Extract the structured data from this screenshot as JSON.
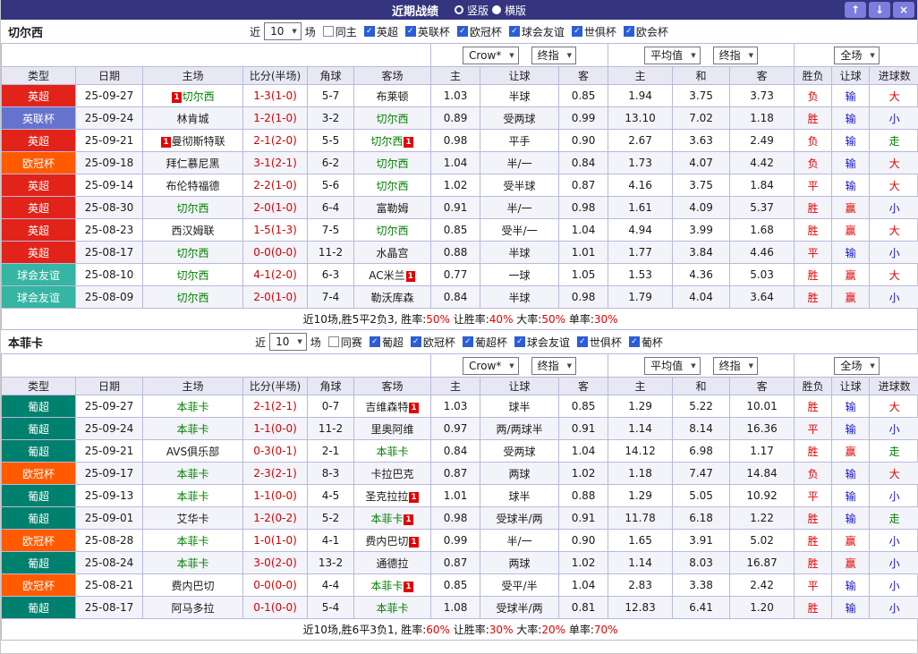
{
  "titlebar": {
    "title": "近期战绩",
    "radios": [
      {
        "label": "竖版",
        "selected": true
      },
      {
        "label": "横版",
        "selected": false
      }
    ],
    "buttons": [
      {
        "name": "scroll-up-button",
        "glyph": "↑"
      },
      {
        "name": "scroll-down-button",
        "glyph": "↓"
      },
      {
        "name": "close-button",
        "glyph": "×"
      }
    ]
  },
  "columns": [
    "类型",
    "日期",
    "主场",
    "比分(半场)",
    "角球",
    "客场",
    "主",
    "让球",
    "客",
    "主",
    "和",
    "客",
    "胜负",
    "让球",
    "进球数"
  ],
  "colors": {
    "leagues": {
      "英超": "#e2231a",
      "英联杯": "#6673ce",
      "欧冠杯": "#ff5a00",
      "球会友谊": "#35b5a2",
      "葡超": "#00806e"
    },
    "results": {
      "胜": "#e60000",
      "平": "#e60000",
      "负": "#e60000",
      "赢": "#e60000",
      "输": "#1414cc",
      "大": "#e60000",
      "小": "#1414cc",
      "走": "#008000"
    }
  },
  "sections": [
    {
      "team": "切尔西",
      "filter": {
        "prefix": "近",
        "count": "10",
        "suffix": "场",
        "checkboxes": [
          {
            "label": "同主",
            "checked": false
          },
          {
            "label": "英超",
            "checked": true
          },
          {
            "label": "英联杯",
            "checked": true
          },
          {
            "label": "欧冠杯",
            "checked": true
          },
          {
            "label": "球会友谊",
            "checked": true
          },
          {
            "label": "世俱杯",
            "checked": true
          },
          {
            "label": "欧会杯",
            "checked": true
          }
        ]
      },
      "dropdown_groups": [
        [
          "Crow*",
          "终指"
        ],
        [
          "平均值",
          "终指"
        ],
        [
          "全场"
        ]
      ],
      "rows": [
        {
          "league": "英超",
          "date": "25-09-27",
          "home": {
            "name": "切尔西",
            "self": true,
            "badge": "1",
            "badge_pos": "before"
          },
          "score": "1-3(1-0)",
          "corners": "5-7",
          "away": {
            "name": "布莱顿"
          },
          "odds": [
            "1.03",
            "半球",
            "0.85"
          ],
          "avg": [
            "1.94",
            "3.75",
            "3.73"
          ],
          "results": [
            "负",
            "输",
            "大"
          ]
        },
        {
          "league": "英联杯",
          "date": "25-09-24",
          "home": {
            "name": "林肯城"
          },
          "score": "1-2(1-0)",
          "corners": "3-2",
          "away": {
            "name": "切尔西",
            "self": true
          },
          "odds": [
            "0.89",
            "受两球",
            "0.99"
          ],
          "avg": [
            "13.10",
            "7.02",
            "1.18"
          ],
          "results": [
            "胜",
            "输",
            "小"
          ]
        },
        {
          "league": "英超",
          "date": "25-09-21",
          "home": {
            "name": "曼彻斯特联",
            "badge": "1",
            "badge_pos": "before"
          },
          "score": "2-1(2-0)",
          "corners": "5-5",
          "away": {
            "name": "切尔西",
            "self": true,
            "badge": "1",
            "badge_pos": "after"
          },
          "odds": [
            "0.98",
            "平手",
            "0.90"
          ],
          "avg": [
            "2.67",
            "3.63",
            "2.49"
          ],
          "results": [
            "负",
            "输",
            "走"
          ]
        },
        {
          "league": "欧冠杯",
          "date": "25-09-18",
          "home": {
            "name": "拜仁慕尼黑"
          },
          "score": "3-1(2-1)",
          "corners": "6-2",
          "away": {
            "name": "切尔西",
            "self": true
          },
          "odds": [
            "1.04",
            "半/一",
            "0.84"
          ],
          "avg": [
            "1.73",
            "4.07",
            "4.42"
          ],
          "results": [
            "负",
            "输",
            "大"
          ]
        },
        {
          "league": "英超",
          "date": "25-09-14",
          "home": {
            "name": "布伦特福德"
          },
          "score": "2-2(1-0)",
          "corners": "5-6",
          "away": {
            "name": "切尔西",
            "self": true
          },
          "odds": [
            "1.02",
            "受半球",
            "0.87"
          ],
          "avg": [
            "4.16",
            "3.75",
            "1.84"
          ],
          "results": [
            "平",
            "输",
            "大"
          ]
        },
        {
          "league": "英超",
          "date": "25-08-30",
          "home": {
            "name": "切尔西",
            "self": true
          },
          "score": "2-0(1-0)",
          "corners": "6-4",
          "away": {
            "name": "富勒姆"
          },
          "odds": [
            "0.91",
            "半/一",
            "0.98"
          ],
          "avg": [
            "1.61",
            "4.09",
            "5.37"
          ],
          "results": [
            "胜",
            "赢",
            "小"
          ]
        },
        {
          "league": "英超",
          "date": "25-08-23",
          "home": {
            "name": "西汉姆联"
          },
          "score": "1-5(1-3)",
          "corners": "7-5",
          "away": {
            "name": "切尔西",
            "self": true
          },
          "odds": [
            "0.85",
            "受半/一",
            "1.04"
          ],
          "avg": [
            "4.94",
            "3.99",
            "1.68"
          ],
          "results": [
            "胜",
            "赢",
            "大"
          ]
        },
        {
          "league": "英超",
          "date": "25-08-17",
          "home": {
            "name": "切尔西",
            "self": true
          },
          "score": "0-0(0-0)",
          "corners": "11-2",
          "away": {
            "name": "水晶宫"
          },
          "odds": [
            "0.88",
            "半球",
            "1.01"
          ],
          "avg": [
            "1.77",
            "3.84",
            "4.46"
          ],
          "results": [
            "平",
            "输",
            "小"
          ]
        },
        {
          "league": "球会友谊",
          "date": "25-08-10",
          "home": {
            "name": "切尔西",
            "self": true
          },
          "score": "4-1(2-0)",
          "corners": "6-3",
          "away": {
            "name": "AC米兰",
            "badge": "1",
            "badge_pos": "after"
          },
          "odds": [
            "0.77",
            "一球",
            "1.05"
          ],
          "avg": [
            "1.53",
            "4.36",
            "5.03"
          ],
          "results": [
            "胜",
            "赢",
            "大"
          ]
        },
        {
          "league": "球会友谊",
          "date": "25-08-09",
          "home": {
            "name": "切尔西",
            "self": true
          },
          "score": "2-0(1-0)",
          "corners": "7-4",
          "away": {
            "name": "勒沃库森"
          },
          "odds": [
            "0.84",
            "半球",
            "0.98"
          ],
          "avg": [
            "1.79",
            "4.04",
            "3.64"
          ],
          "results": [
            "胜",
            "赢",
            "小"
          ]
        }
      ],
      "summary": {
        "prefix": "近10场,胜5平2负3,",
        "stats": [
          {
            "label": "胜率:",
            "value": "50%"
          },
          {
            "label": "让胜率:",
            "value": "40%"
          },
          {
            "label": "大率:",
            "value": "50%"
          },
          {
            "label": "单率:",
            "value": "30%"
          }
        ]
      }
    },
    {
      "team": "本菲卡",
      "filter": {
        "prefix": "近",
        "count": "10",
        "suffix": "场",
        "checkboxes": [
          {
            "label": "同赛",
            "checked": false
          },
          {
            "label": "葡超",
            "checked": true
          },
          {
            "label": "欧冠杯",
            "checked": true
          },
          {
            "label": "葡超杯",
            "checked": true
          },
          {
            "label": "球会友谊",
            "checked": true
          },
          {
            "label": "世俱杯",
            "checked": true
          },
          {
            "label": "葡杯",
            "checked": true
          }
        ]
      },
      "dropdown_groups": [
        [
          "Crow*",
          "终指"
        ],
        [
          "平均值",
          "终指"
        ],
        [
          "全场"
        ]
      ],
      "rows": [
        {
          "league": "葡超",
          "date": "25-09-27",
          "home": {
            "name": "本菲卡",
            "self": true
          },
          "score": "2-1(2-1)",
          "corners": "0-7",
          "away": {
            "name": "吉维森特",
            "badge": "1",
            "badge_pos": "after"
          },
          "odds": [
            "1.03",
            "球半",
            "0.85"
          ],
          "avg": [
            "1.29",
            "5.22",
            "10.01"
          ],
          "results": [
            "胜",
            "输",
            "大"
          ]
        },
        {
          "league": "葡超",
          "date": "25-09-24",
          "home": {
            "name": "本菲卡",
            "self": true
          },
          "score": "1-1(0-0)",
          "corners": "11-2",
          "away": {
            "name": "里奥阿维"
          },
          "odds": [
            "0.97",
            "两/两球半",
            "0.91"
          ],
          "avg": [
            "1.14",
            "8.14",
            "16.36"
          ],
          "results": [
            "平",
            "输",
            "小"
          ]
        },
        {
          "league": "葡超",
          "date": "25-09-21",
          "home": {
            "name": "AVS俱乐部"
          },
          "score": "0-3(0-1)",
          "corners": "2-1",
          "away": {
            "name": "本菲卡",
            "self": true
          },
          "odds": [
            "0.84",
            "受两球",
            "1.04"
          ],
          "avg": [
            "14.12",
            "6.98",
            "1.17"
          ],
          "results": [
            "胜",
            "赢",
            "走"
          ]
        },
        {
          "league": "欧冠杯",
          "date": "25-09-17",
          "home": {
            "name": "本菲卡",
            "self": true
          },
          "score": "2-3(2-1)",
          "corners": "8-3",
          "away": {
            "name": "卡拉巴克"
          },
          "odds": [
            "0.87",
            "两球",
            "1.02"
          ],
          "avg": [
            "1.18",
            "7.47",
            "14.84"
          ],
          "results": [
            "负",
            "输",
            "大"
          ]
        },
        {
          "league": "葡超",
          "date": "25-09-13",
          "home": {
            "name": "本菲卡",
            "self": true
          },
          "score": "1-1(0-0)",
          "corners": "4-5",
          "away": {
            "name": "圣克拉拉",
            "badge": "1",
            "badge_pos": "after"
          },
          "odds": [
            "1.01",
            "球半",
            "0.88"
          ],
          "avg": [
            "1.29",
            "5.05",
            "10.92"
          ],
          "results": [
            "平",
            "输",
            "小"
          ]
        },
        {
          "league": "葡超",
          "date": "25-09-01",
          "home": {
            "name": "艾华卡"
          },
          "score": "1-2(0-2)",
          "corners": "5-2",
          "away": {
            "name": "本菲卡",
            "self": true,
            "badge": "1",
            "badge_pos": "after"
          },
          "odds": [
            "0.98",
            "受球半/两",
            "0.91"
          ],
          "avg": [
            "11.78",
            "6.18",
            "1.22"
          ],
          "results": [
            "胜",
            "输",
            "走"
          ]
        },
        {
          "league": "欧冠杯",
          "date": "25-08-28",
          "home": {
            "name": "本菲卡",
            "self": true
          },
          "score": "1-0(1-0)",
          "corners": "4-1",
          "away": {
            "name": "费内巴切",
            "badge": "1",
            "badge_pos": "after"
          },
          "odds": [
            "0.99",
            "半/一",
            "0.90"
          ],
          "avg": [
            "1.65",
            "3.91",
            "5.02"
          ],
          "results": [
            "胜",
            "赢",
            "小"
          ]
        },
        {
          "league": "葡超",
          "date": "25-08-24",
          "home": {
            "name": "本菲卡",
            "self": true
          },
          "score": "3-0(2-0)",
          "corners": "13-2",
          "away": {
            "name": "通德拉"
          },
          "odds": [
            "0.87",
            "两球",
            "1.02"
          ],
          "avg": [
            "1.14",
            "8.03",
            "16.87"
          ],
          "results": [
            "胜",
            "赢",
            "小"
          ]
        },
        {
          "league": "欧冠杯",
          "date": "25-08-21",
          "home": {
            "name": "费内巴切"
          },
          "score": "0-0(0-0)",
          "corners": "4-4",
          "away": {
            "name": "本菲卡",
            "self": true,
            "badge": "1",
            "badge_pos": "after"
          },
          "odds": [
            "0.85",
            "受平/半",
            "1.04"
          ],
          "avg": [
            "2.83",
            "3.38",
            "2.42"
          ],
          "results": [
            "平",
            "输",
            "小"
          ]
        },
        {
          "league": "葡超",
          "date": "25-08-17",
          "home": {
            "name": "阿马多拉"
          },
          "score": "0-1(0-0)",
          "corners": "5-4",
          "away": {
            "name": "本菲卡",
            "self": true
          },
          "odds": [
            "1.08",
            "受球半/两",
            "0.81"
          ],
          "avg": [
            "12.83",
            "6.41",
            "1.20"
          ],
          "results": [
            "胜",
            "输",
            "小"
          ]
        }
      ],
      "summary": {
        "prefix": "近10场,胜6平3负1,",
        "stats": [
          {
            "label": "胜率:",
            "value": "60%"
          },
          {
            "label": "让胜率:",
            "value": "30%"
          },
          {
            "label": "大率:",
            "value": "20%"
          },
          {
            "label": "单率:",
            "value": "70%"
          }
        ]
      }
    }
  ]
}
